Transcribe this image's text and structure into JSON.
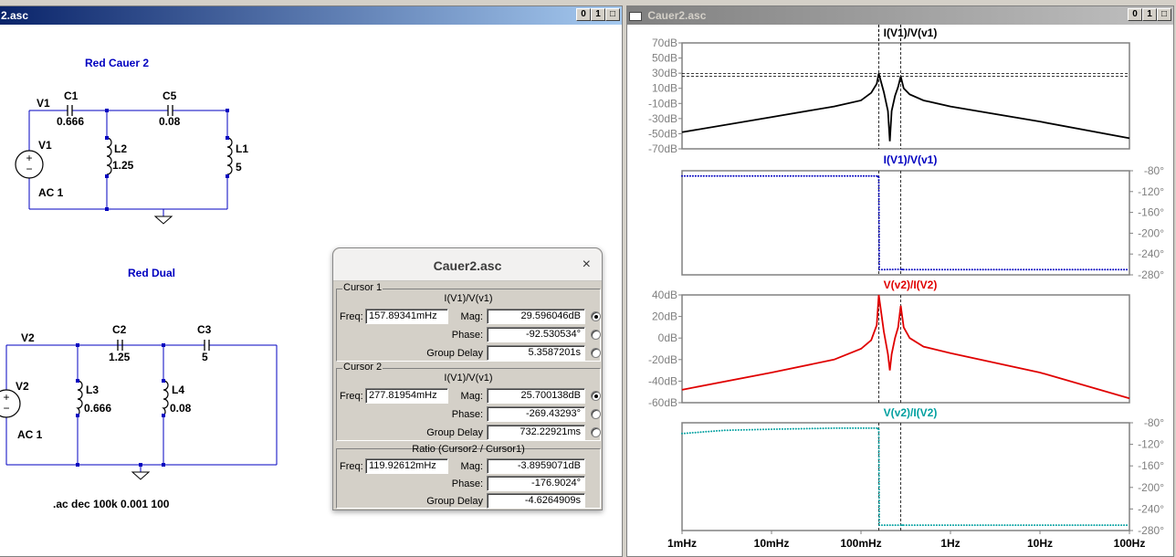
{
  "schematic_window": {
    "title": "2.asc",
    "controls": [
      "0",
      "1",
      "□"
    ],
    "circuit1": {
      "title": "Red Cauer 2",
      "source_label": "V1",
      "source_value": "AC 1",
      "node_label": "V1",
      "c1_name": "C1",
      "c1_value": "0.666",
      "c5_name": "C5",
      "c5_value": "0.08",
      "l2_name": "L2",
      "l2_value": "1.25",
      "l1_name": "L1",
      "l1_value": "5"
    },
    "circuit2": {
      "title": "Red Dual",
      "source_label": "V2",
      "source_value": "AC 1",
      "node_label": "V2",
      "c2_name": "C2",
      "c2_value": "1.25",
      "c3_name": "C3",
      "c3_value": "5",
      "l3_name": "L3",
      "l3_value": "0.666",
      "l4_name": "L4",
      "l4_value": "0.08"
    },
    "directive": ".ac dec 100k 0.001 100"
  },
  "plot_window": {
    "title": "Cauer2.asc",
    "controls": [
      "0",
      "1",
      "□"
    ]
  },
  "cursor_dialog": {
    "title": "Cauer2.asc",
    "close": "×",
    "cursor1": {
      "group": "Cursor 1",
      "trace": "I(V1)/V(v1)",
      "freq_label": "Freq:",
      "freq": "157.89341mHz",
      "mag_label": "Mag:",
      "mag": "29.596046dB",
      "phase_label": "Phase:",
      "phase": "-92.530534°",
      "gd_label": "Group Delay",
      "gd": "5.3587201s"
    },
    "cursor2": {
      "group": "Cursor 2",
      "trace": "I(V1)/V(v1)",
      "freq_label": "Freq:",
      "freq": "277.81954mHz",
      "mag_label": "Mag:",
      "mag": "25.700138dB",
      "phase_label": "Phase:",
      "phase": "-269.43293°",
      "gd_label": "Group Delay",
      "gd": "732.22921ms"
    },
    "ratio": {
      "group": "Ratio (Cursor2 / Cursor1)",
      "freq_label": "Freq:",
      "freq": "119.92612mHz",
      "mag_label": "Mag:",
      "mag": "-3.8959071dB",
      "phase_label": "Phase:",
      "phase": "-176.9024°",
      "gd_label": "Group Delay",
      "gd": "-4.6264909s"
    }
  },
  "chart_data": [
    {
      "type": "line",
      "title": "I(V1)/V(v1)",
      "color": "#000000",
      "quantity": "magnitude",
      "yticks": [
        "70dB",
        "50dB",
        "30dB",
        "10dB",
        "-10dB",
        "-30dB",
        "-50dB",
        "-70dB"
      ],
      "ylim": [
        -70,
        70
      ],
      "x": [
        0.001,
        0.01,
        0.05,
        0.1,
        0.13,
        0.15,
        0.158,
        0.18,
        0.2,
        0.21,
        0.22,
        0.24,
        0.26,
        0.278,
        0.3,
        0.35,
        0.5,
        1,
        10,
        100
      ],
      "values": [
        -48,
        -28,
        -14,
        -6,
        4,
        16,
        29.6,
        5,
        -20,
        -60,
        -20,
        0,
        12,
        25.7,
        10,
        2,
        -6,
        -14,
        -34,
        -56
      ],
      "cursor_levels_db": [
        29.6,
        25.7
      ]
    },
    {
      "type": "scatter",
      "title": "I(V1)/V(v1)",
      "color": "#0000c0",
      "quantity": "phase",
      "yticks": [
        "-80°",
        "-120°",
        "-160°",
        "-200°",
        "-240°",
        "-280°"
      ],
      "ylim": [
        -280,
        -80
      ],
      "x": [
        0.001,
        0.01,
        0.1,
        0.15,
        0.158,
        0.16,
        0.278,
        0.3,
        1,
        10,
        100
      ],
      "values": [
        -90,
        -90,
        -90,
        -90,
        -92.5,
        -270,
        -269.4,
        -270,
        -270,
        -270,
        -270
      ]
    },
    {
      "type": "line",
      "title": "V(v2)/I(V2)",
      "color": "#e00000",
      "quantity": "magnitude",
      "yticks": [
        "40dB",
        "20dB",
        "0dB",
        "-20dB",
        "-40dB",
        "-60dB"
      ],
      "ylim": [
        -60,
        40
      ],
      "x": [
        0.001,
        0.01,
        0.05,
        0.1,
        0.13,
        0.15,
        0.158,
        0.18,
        0.2,
        0.21,
        0.22,
        0.24,
        0.26,
        0.278,
        0.3,
        0.35,
        0.5,
        1,
        10,
        100
      ],
      "values": [
        -48,
        -32,
        -20,
        -10,
        -2,
        12,
        40,
        6,
        -15,
        -30,
        -15,
        0,
        10,
        30,
        10,
        0,
        -8,
        -14,
        -32,
        -56
      ]
    },
    {
      "type": "scatter",
      "title": "V(v2)/I(V2)",
      "color": "#00a0a0",
      "quantity": "phase",
      "yticks": [
        "-80°",
        "-120°",
        "-160°",
        "-200°",
        "-240°",
        "-280°"
      ],
      "ylim": [
        -280,
        -80
      ],
      "x": [
        0.001,
        0.003,
        0.01,
        0.05,
        0.1,
        0.15,
        0.158,
        0.16,
        0.278,
        0.3,
        1,
        10,
        100
      ],
      "values": [
        -100,
        -94,
        -92,
        -90,
        -90,
        -90,
        -92,
        -270,
        -270,
        -270,
        -270,
        -270,
        -270
      ]
    }
  ],
  "x_axis": {
    "ticks": [
      "1mHz",
      "10mHz",
      "100mHz",
      "1Hz",
      "10Hz",
      "100Hz"
    ],
    "xlim": [
      0.001,
      100
    ],
    "scale": "log",
    "cursor1_x": 0.15789341,
    "cursor2_x": 0.27781954
  }
}
